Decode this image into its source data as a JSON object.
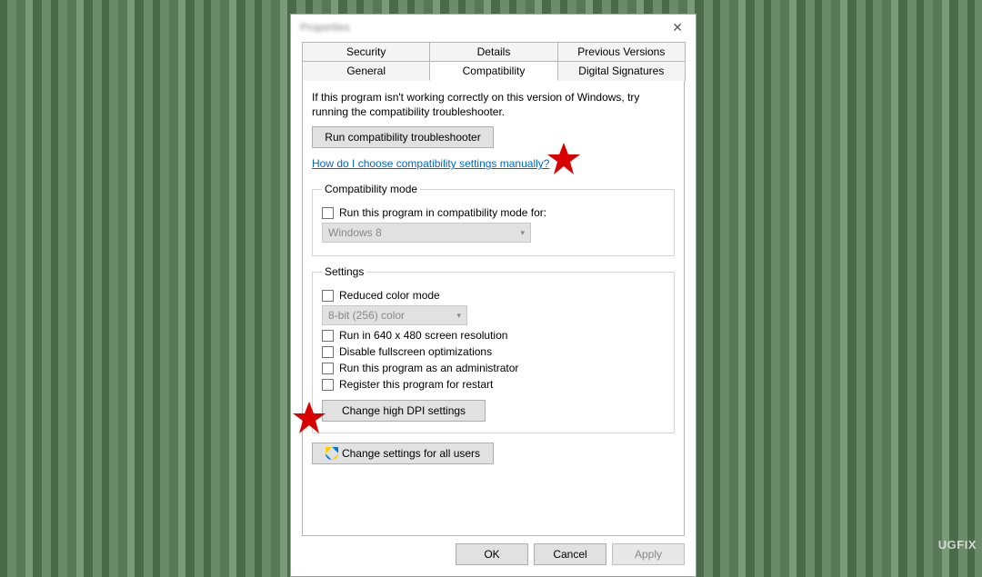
{
  "window": {
    "title": "Properties"
  },
  "tabs": {
    "row1": [
      "Security",
      "Details",
      "Previous Versions"
    ],
    "row2": [
      "General",
      "Compatibility",
      "Digital Signatures"
    ],
    "active": "Compatibility"
  },
  "intro": "If this program isn't working correctly on this version of Windows, try running the compatibility troubleshooter.",
  "run_troubleshooter": "Run compatibility troubleshooter",
  "help_link": "How do I choose compatibility settings manually?",
  "compat_mode": {
    "legend": "Compatibility mode",
    "checkbox": "Run this program in compatibility mode for:",
    "select": "Windows 8"
  },
  "settings": {
    "legend": "Settings",
    "reduced_color": "Reduced color mode",
    "color_select": "8-bit (256) color",
    "run_640": "Run in 640 x 480 screen resolution",
    "disable_fullscreen": "Disable fullscreen optimizations",
    "run_as_admin": "Run this program as an administrator",
    "register_restart": "Register this program for restart",
    "dpi_button": "Change high DPI settings"
  },
  "all_users_button": "Change settings for all users",
  "buttons": {
    "ok": "OK",
    "cancel": "Cancel",
    "apply": "Apply"
  },
  "watermark": {
    "prefix": "UG",
    "suffix": "FIX"
  }
}
